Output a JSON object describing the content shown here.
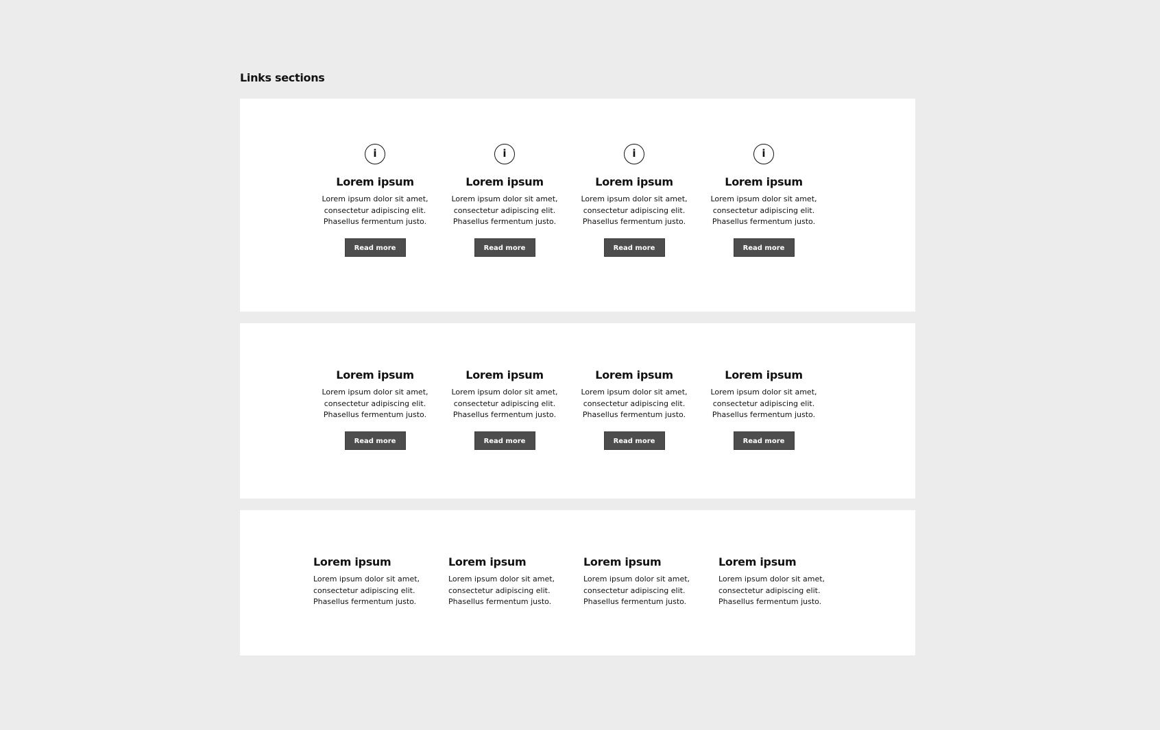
{
  "page": {
    "title": "Links sections"
  },
  "sections": [
    {
      "has_icon": true,
      "icon": "info-icon",
      "items": [
        {
          "icon_glyph": "i",
          "title": "Lorem ipsum",
          "lines": [
            "Lorem ipsum dolor sit amet,",
            "consectetur adipiscing elit.",
            "Phasellus fermentum justo."
          ],
          "button": "Read more"
        },
        {
          "icon_glyph": "i",
          "title": "Lorem ipsum",
          "lines": [
            "Lorem ipsum dolor sit amet,",
            "consectetur adipiscing elit.",
            "Phasellus fermentum justo."
          ],
          "button": "Read more"
        },
        {
          "icon_glyph": "i",
          "title": "Lorem ipsum",
          "lines": [
            "Lorem ipsum dolor sit amet,",
            "consectetur adipiscing elit.",
            "Phasellus fermentum justo."
          ],
          "button": "Read more"
        },
        {
          "icon_glyph": "i",
          "title": "Lorem ipsum",
          "lines": [
            "Lorem ipsum dolor sit amet,",
            "consectetur adipiscing elit.",
            "Phasellus fermentum justo."
          ],
          "button": "Read more"
        }
      ]
    },
    {
      "has_icon": false,
      "items": [
        {
          "title": "Lorem ipsum",
          "lines": [
            "Lorem ipsum dolor sit amet,",
            "consectetur adipiscing elit.",
            "Phasellus fermentum justo."
          ],
          "button": "Read more"
        },
        {
          "title": "Lorem ipsum",
          "lines": [
            "Lorem ipsum dolor sit amet,",
            "consectetur adipiscing elit.",
            "Phasellus fermentum justo."
          ],
          "button": "Read more"
        },
        {
          "title": "Lorem ipsum",
          "lines": [
            "Lorem ipsum dolor sit amet,",
            "consectetur adipiscing elit.",
            "Phasellus fermentum justo."
          ],
          "button": "Read more"
        },
        {
          "title": "Lorem ipsum",
          "lines": [
            "Lorem ipsum dolor sit amet,",
            "consectetur adipiscing elit.",
            "Phasellus fermentum justo."
          ],
          "button": "Read more"
        }
      ]
    },
    {
      "has_icon": false,
      "items": [
        {
          "title": "Lorem ipsum",
          "lines": [
            "Lorem ipsum dolor sit amet,",
            "consectetur adipiscing elit.",
            "Phasellus fermentum justo."
          ]
        },
        {
          "title": "Lorem ipsum",
          "lines": [
            "Lorem ipsum dolor sit amet,",
            "consectetur adipiscing elit.",
            "Phasellus fermentum justo."
          ]
        },
        {
          "title": "Lorem ipsum",
          "lines": [
            "Lorem ipsum dolor sit amet,",
            "consectetur adipiscing elit.",
            "Phasellus fermentum justo."
          ]
        },
        {
          "title": "Lorem ipsum",
          "lines": [
            "Lorem ipsum dolor sit amet,",
            "consectetur adipiscing elit.",
            "Phasellus fermentum justo."
          ]
        }
      ]
    }
  ],
  "colors": {
    "background": "#ececec",
    "panel": "#ffffff",
    "button": "#4d4d4d",
    "button_text": "#ffffff",
    "text": "#111111"
  }
}
